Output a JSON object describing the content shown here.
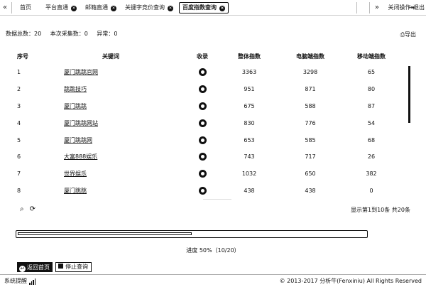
{
  "tabs": [
    {
      "label": "首页",
      "closable": false
    },
    {
      "label": "平台直通",
      "closable": true
    },
    {
      "label": "邮箱直通",
      "closable": true
    },
    {
      "label": "关键字竞价查询",
      "closable": true
    },
    {
      "label": "百度指数查询",
      "closable": true,
      "active": true
    }
  ],
  "top_right": {
    "close_ops": "关闭操作",
    "exit": "退出"
  },
  "summary": {
    "total": "数据总数：20",
    "collected": "本次采集数：0",
    "abnormal": "异常：0"
  },
  "export_label": "导出",
  "table": {
    "headers": [
      "序号",
      "关键词",
      "收录",
      "整体指数",
      "电脑端指数",
      "移动端指数"
    ],
    "rows": [
      {
        "idx": "1",
        "keyword": "厦门跳跳官网",
        "total": "3363",
        "pc": "3298",
        "mobile": "65"
      },
      {
        "idx": "2",
        "keyword": "跳跳技巧",
        "total": "951",
        "pc": "871",
        "mobile": "80"
      },
      {
        "idx": "3",
        "keyword": "厦门跳跳",
        "total": "675",
        "pc": "588",
        "mobile": "87"
      },
      {
        "idx": "4",
        "keyword": "厦门跳跳网站",
        "total": "830",
        "pc": "776",
        "mobile": "54"
      },
      {
        "idx": "5",
        "keyword": "厦门跳跳网",
        "total": "653",
        "pc": "585",
        "mobile": "68"
      },
      {
        "idx": "6",
        "keyword": "大富888娱乐",
        "total": "743",
        "pc": "717",
        "mobile": "26"
      },
      {
        "idx": "7",
        "keyword": "世界娱乐",
        "total": "1032",
        "pc": "650",
        "mobile": "382"
      },
      {
        "idx": "8",
        "keyword": "厦门跳跳",
        "total": "438",
        "pc": "438",
        "mobile": "0"
      }
    ]
  },
  "pager": "显示第1到10条 共20条",
  "progress": {
    "fraction": 0.5,
    "text": "进度 50%（10/20）"
  },
  "buttons": {
    "back": "返回首页",
    "stop": "停止查询"
  },
  "footer": {
    "status": "系统提醒",
    "copyright": "© 2013-2017 分析牛(Fenxiniu) All Rights Reserved"
  }
}
